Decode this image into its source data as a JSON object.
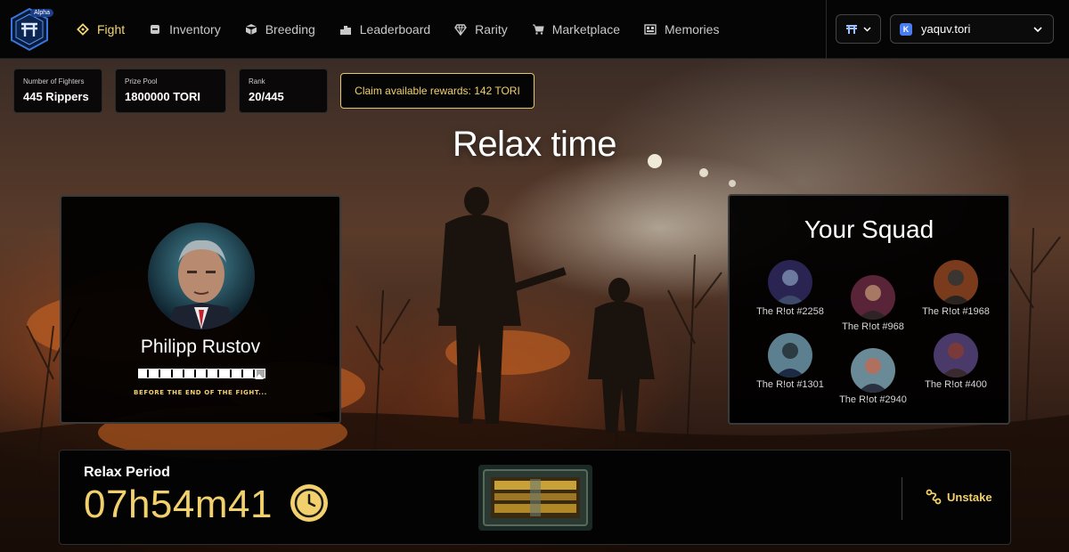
{
  "header": {
    "logo_badge": "Alpha",
    "nav": [
      {
        "label": "Fight",
        "icon": "fight-icon",
        "active": true
      },
      {
        "label": "Inventory",
        "icon": "inventory-icon",
        "active": false
      },
      {
        "label": "Breeding",
        "icon": "breeding-icon",
        "active": false
      },
      {
        "label": "Leaderboard",
        "icon": "leaderboard-icon",
        "active": false
      },
      {
        "label": "Rarity",
        "icon": "rarity-icon",
        "active": false
      },
      {
        "label": "Marketplace",
        "icon": "marketplace-icon",
        "active": false
      },
      {
        "label": "Memories",
        "icon": "memories-icon",
        "active": false
      }
    ],
    "wallet": {
      "badge": "K",
      "name": "yaquv.tori"
    }
  },
  "stats": [
    {
      "label": "Number of Fighters",
      "value": "445 Rippers"
    },
    {
      "label": "Prize Pool",
      "value": "1800000 TORI"
    },
    {
      "label": "Rank",
      "value": "20/445"
    }
  ],
  "claim_label": "Claim available rewards: 142 TORI",
  "page_title": "Relax time",
  "boss": {
    "name": "Philipp Rustov",
    "health_fraction": 0.92,
    "note": "BEFORE THE END OF THE FIGHT..."
  },
  "squad": {
    "title": "Your Squad",
    "members": [
      {
        "name": "The R!ot #2258"
      },
      {
        "name": "The R!ot #968"
      },
      {
        "name": "The R!ot #1968"
      },
      {
        "name": "The R!ot #1301"
      },
      {
        "name": "The R!ot #2940"
      },
      {
        "name": "The R!ot #400"
      }
    ]
  },
  "relax": {
    "label": "Relax Period",
    "countdown": "07h54m41",
    "unstake_label": "Unstake"
  },
  "colors": {
    "accent": "#f2d06b",
    "panel": "#000000",
    "border": "#3a3a3a"
  }
}
